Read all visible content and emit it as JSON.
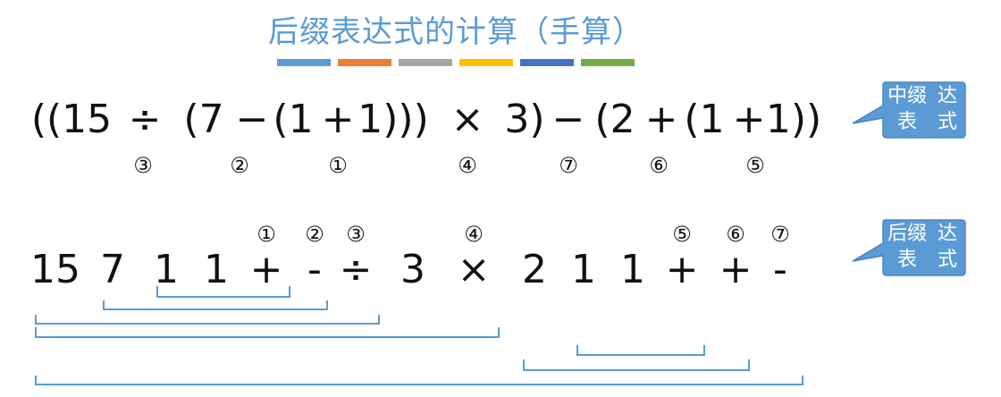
{
  "title": "后缀表达式的计算（手算）",
  "color_bars": [
    "#5b9bd5",
    "#ed7d31",
    "#a5a5a5",
    "#ffc000",
    "#4472c4",
    "#70ad47"
  ],
  "infix": {
    "tokens": [
      "((15",
      "÷",
      "(7",
      "−",
      "(1",
      "+",
      "1)))",
      "×",
      "3)",
      "−",
      "(2",
      "+",
      "(1",
      "+",
      "1))"
    ],
    "order_marks": [
      "③",
      "②",
      "①",
      "④",
      "⑦",
      "⑥",
      "⑤"
    ],
    "callout": "中缀表达式"
  },
  "postfix": {
    "tokens": [
      "15",
      "7",
      "1",
      "1",
      "+",
      "-",
      "÷",
      "3",
      "×",
      "2",
      "1",
      "1",
      "+",
      "+",
      "-"
    ],
    "order_marks": [
      "①",
      "②",
      "③",
      "④",
      "⑤",
      "⑥",
      "⑦"
    ],
    "callout": "后缀表达式"
  },
  "colors": {
    "title": "#5b9bd5",
    "callout_fill": "#5b9bd5",
    "callout_stroke": "#4a86c0",
    "bracket": "#5b9bd5"
  }
}
